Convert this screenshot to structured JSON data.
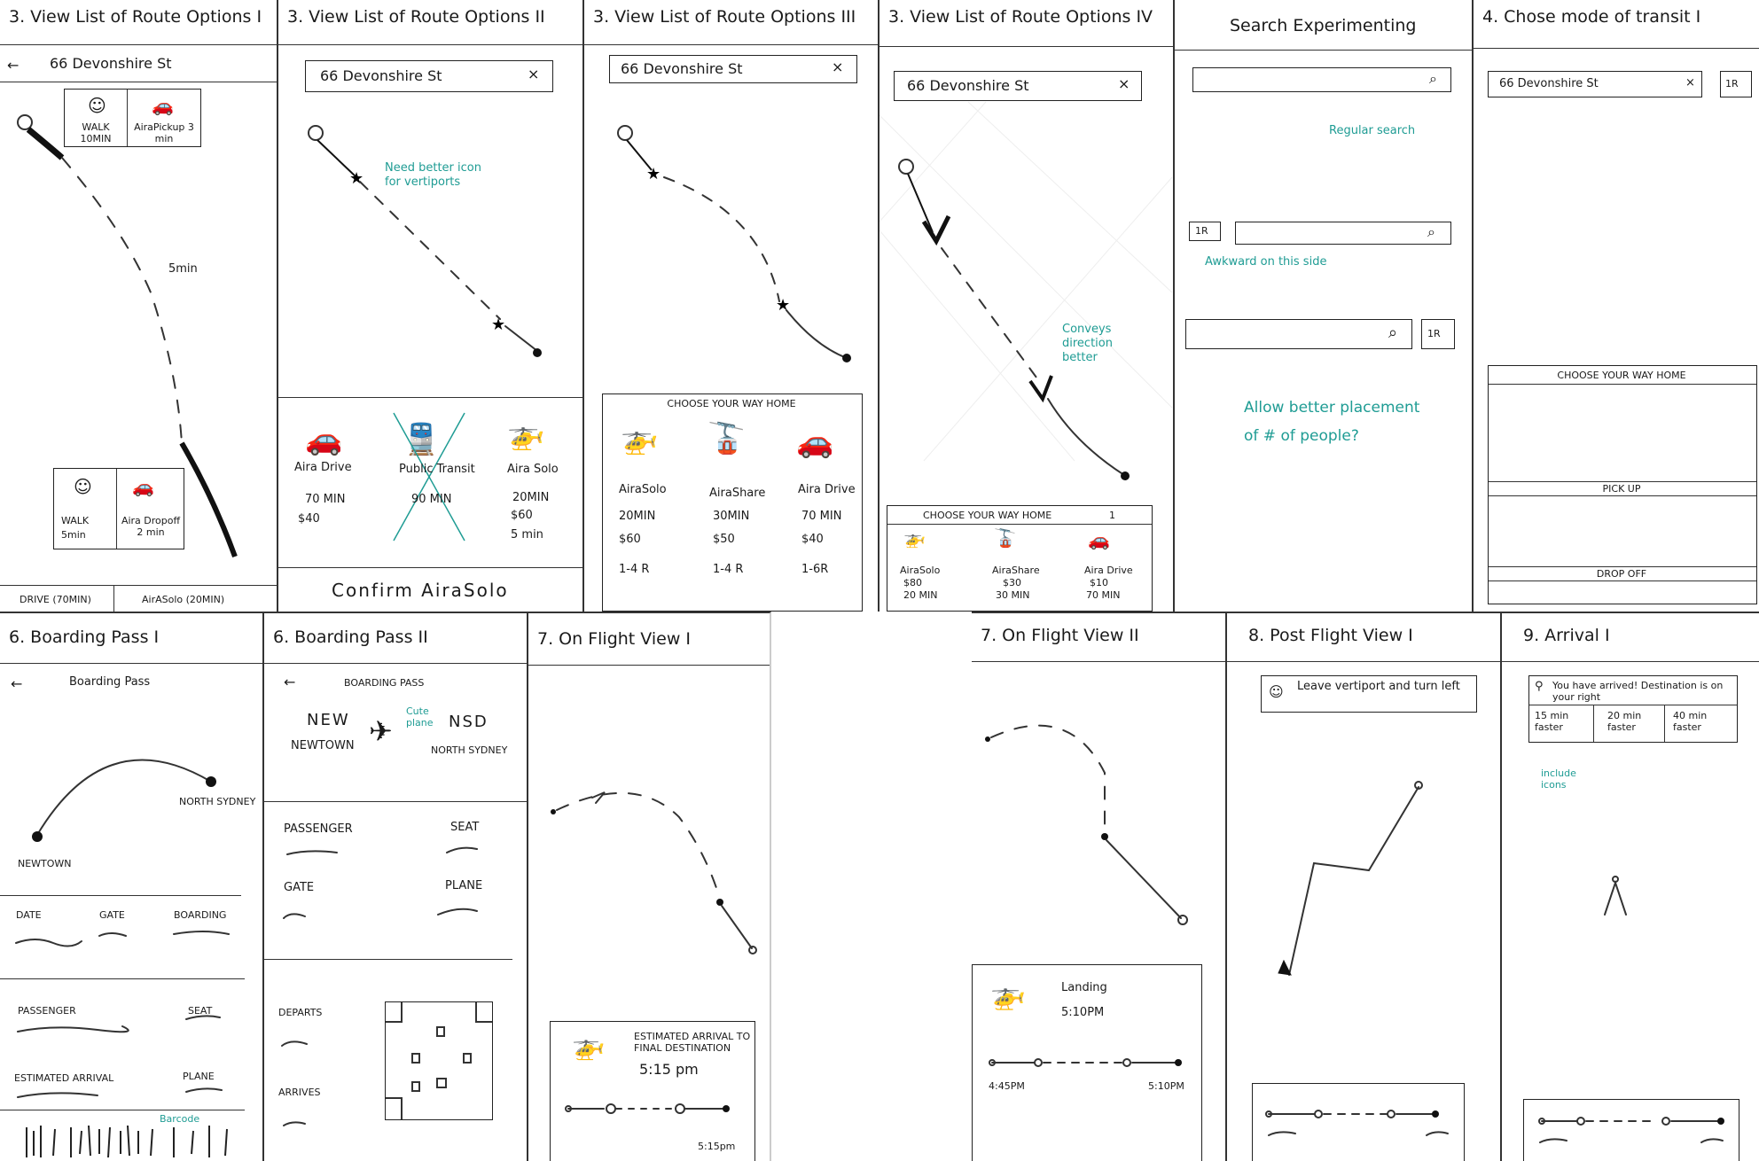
{
  "p1": {
    "title": "3. View List of Route Options I",
    "back_arrow": "←",
    "address": "66 Devonshire St",
    "top_walk": "WALK 10MIN",
    "top_pickup": "AiraPickup 3 min",
    "leg_time": "5min",
    "bottom_walk_a": "WALK",
    "bottom_walk_b": "5min",
    "bottom_dropoff": "Aira Dropoff 2 min",
    "tab_drive": "DRIVE (70MIN)",
    "tab_airasolo": "AirASolo (20MIN)"
  },
  "p2": {
    "title": "3. View List of Route Options II",
    "address": "66 Devonshire St",
    "clear": "×",
    "note": "Need better icon for vertiports",
    "opt1_name": "Aira Drive",
    "opt1_time": "70 MIN",
    "opt1_price": "$40",
    "opt2_name": "Public Transit",
    "opt2_time": "90 MIN",
    "opt3_name": "Aira Solo",
    "opt3_time": "20MIN",
    "opt3_price": "$60",
    "opt3_walk": "5 min",
    "confirm": "Confirm AiraSolo"
  },
  "p3": {
    "title": "3. View List of Route Options III",
    "address": "66 Devonshire St",
    "clear": "×",
    "panel_title": "CHOOSE YOUR WAY HOME",
    "opt1_name": "AiraSolo",
    "opt1_time": "20MIN",
    "opt1_price": "$60",
    "opt1_seats": "1-4 R",
    "opt2_name": "AiraShare",
    "opt2_time": "30MIN",
    "opt2_price": "$50",
    "opt2_seats": "1-4 R",
    "opt3_name": "Aira Drive",
    "opt3_time": "70 MIN",
    "opt3_price": "$40",
    "opt3_seats": "1-6R"
  },
  "p4": {
    "title": "3. View List of Route Options IV",
    "address": "66 Devonshire St",
    "clear": "×",
    "note": "Conveys direction better",
    "panel_title": "CHOOSE YOUR WAY HOME",
    "people": "1",
    "opt1_name": "AiraSolo",
    "opt1_price": "$80",
    "opt1_time": "20 MIN",
    "opt2_name": "AiraShare",
    "opt2_price": "$30",
    "opt2_time": "30 MIN",
    "opt3_name": "Aira Drive",
    "opt3_price": "$10",
    "opt3_time": "70 MIN"
  },
  "p5": {
    "title": "Search Experimenting",
    "note1": "Regular search",
    "people": "1R",
    "note2": "Awkward on this side",
    "note3": "Allow better placement of # of people?"
  },
  "p6": {
    "title": "4. Chose mode of transit I",
    "address": "66 Devonshire St",
    "clear": "×",
    "people": "1R",
    "panel_title": "CHOOSE YOUR WAY HOME",
    "pickup": "PICK UP",
    "dropoff": "DROP OFF"
  },
  "p7": {
    "title": "6. Boarding Pass I",
    "back_arrow": "←",
    "header": "Boarding Pass",
    "dest": "NORTH SYDNEY",
    "origin": "NEWTOWN",
    "date": "DATE",
    "gate": "GATE",
    "boarding": "BOARDING",
    "passenger": "PASSENGER",
    "seat": "SEAT",
    "est_arrival": "ESTIMATED ARRIVAL",
    "plane": "PLANE",
    "note": "Barcode"
  },
  "p8": {
    "title": "6. Boarding Pass II",
    "back_arrow": "←",
    "header": "BOARDING PASS",
    "orig_code": "NEW",
    "orig_name": "NEWTOWN",
    "dest_code": "NSD",
    "dest_name": "NORTH SYDNEY",
    "note": "Cute plane",
    "passenger": "PASSENGER",
    "seat": "SEAT",
    "gate": "GATE",
    "plane": "PLANE",
    "departs": "DEPARTS",
    "arrives": "ARRIVES"
  },
  "p9": {
    "title": "7. On Flight View I",
    "eta_label": "ESTIMATED ARRIVAL TO FINAL DESTINATION",
    "eta_time": "5:15 pm",
    "end_time": "5:15pm"
  },
  "p10": {
    "title": "7. On Flight View II",
    "landing": "Landing",
    "landing_time": "5:10PM",
    "start_time": "4:45PM",
    "end_time": "5:10PM"
  },
  "p11": {
    "title": "8. Post Flight View I",
    "instruction": "Leave vertiport and turn left"
  },
  "p12": {
    "title": "9. Arrival I",
    "arrived": "You have arrived! Destination is on your right",
    "opt1": "15 min faster",
    "opt2": "20 min faster",
    "opt3": "40 min faster",
    "note": "include icons"
  }
}
